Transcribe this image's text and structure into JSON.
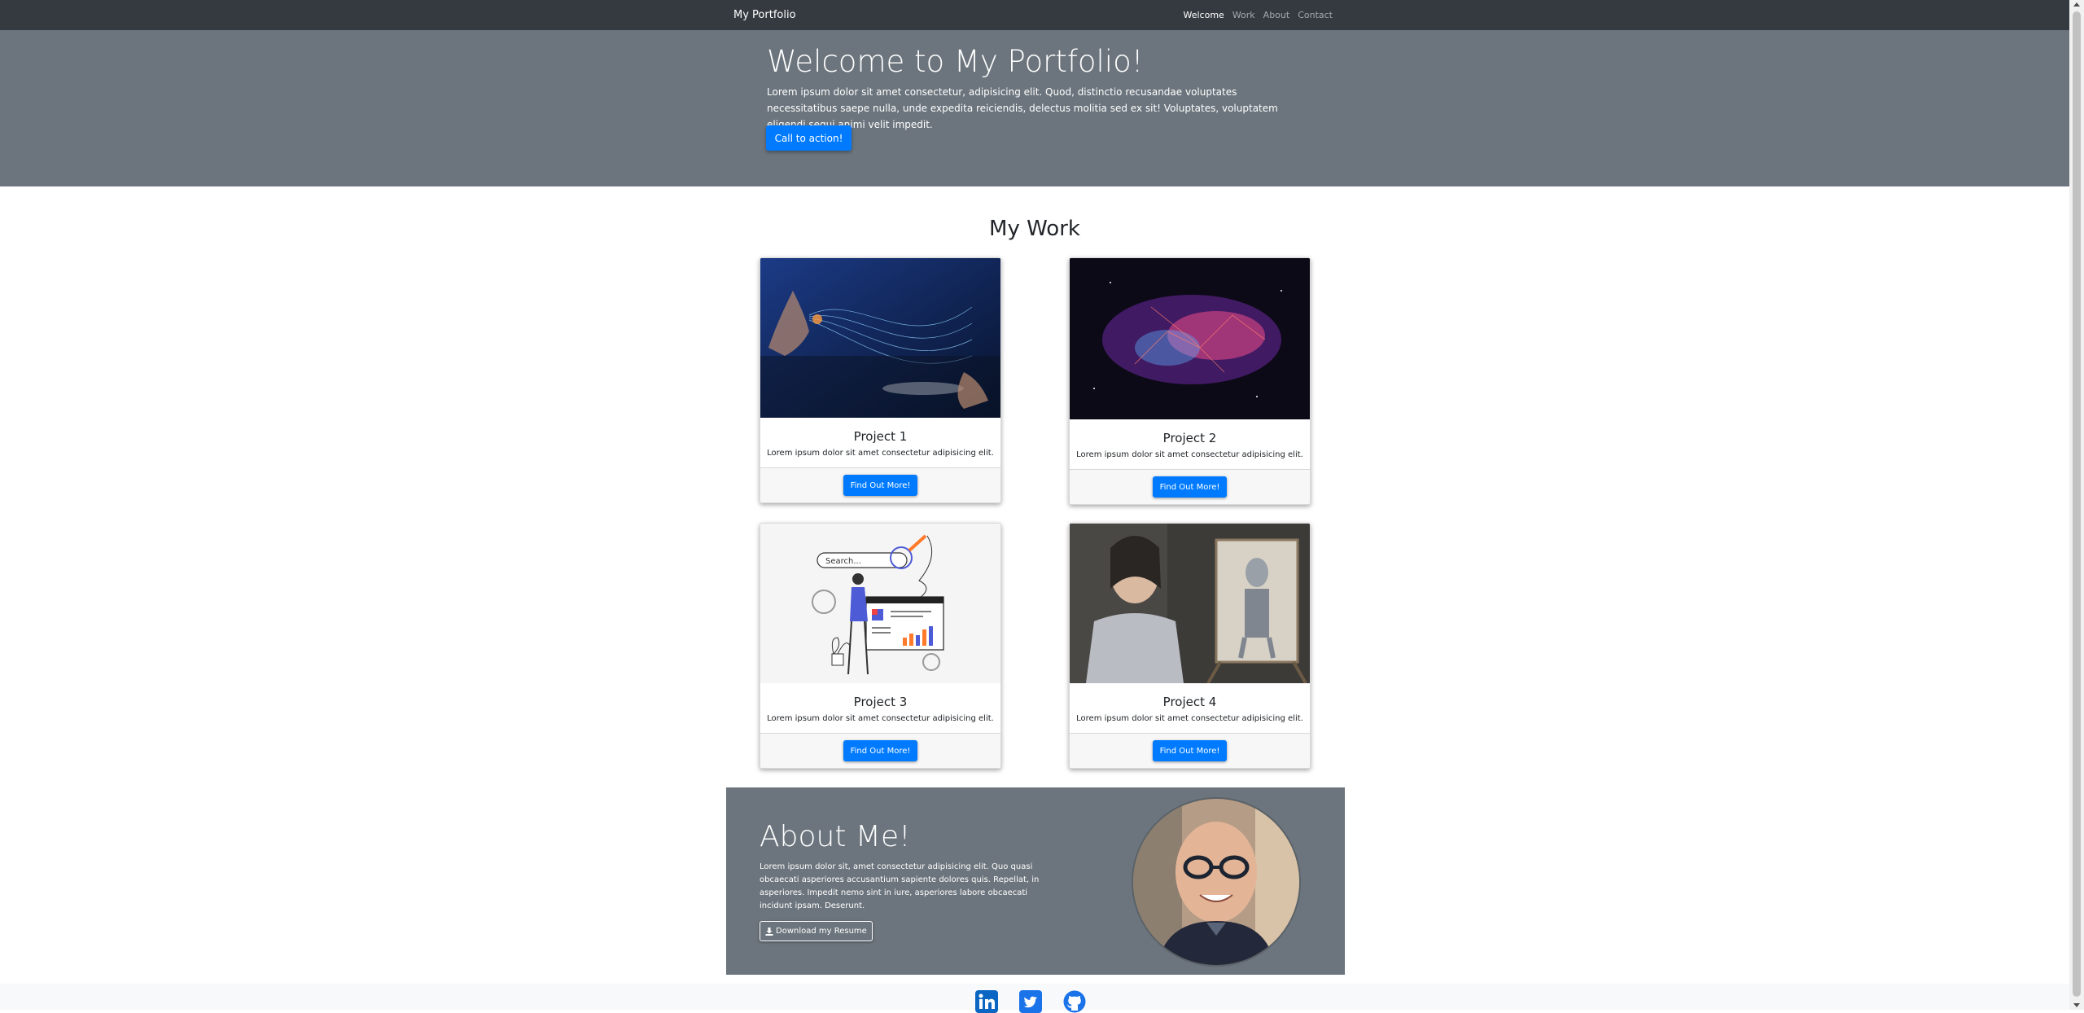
{
  "nav": {
    "brand": "My Portfolio",
    "links": [
      {
        "label": "Welcome",
        "active": true
      },
      {
        "label": "Work",
        "active": false
      },
      {
        "label": "About",
        "active": false
      },
      {
        "label": "Contact",
        "active": false
      }
    ]
  },
  "hero": {
    "title": "Welcome to My Portfolio!",
    "text": "Lorem ipsum dolor sit amet consectetur, adipisicing elit. Quod, distinctio recusandae voluptates necessitatibus saepe nulla, unde expedita reiciendis, delectus molitia sed ex sit! Voluptates, voluptatem eligendi sequi animi velit impedit.",
    "cta_label": "Call to action!"
  },
  "work": {
    "title": "My Work",
    "projects": [
      {
        "title": "Project 1",
        "text": "Lorem ipsum dolor sit amet consectetur adipisicing elit.",
        "button": "Find Out More!"
      },
      {
        "title": "Project 2",
        "text": "Lorem ipsum dolor sit amet consectetur adipisicing elit.",
        "button": "Find Out More!"
      },
      {
        "title": "Project 3",
        "text": "Lorem ipsum dolor sit amet consectetur adipisicing elit.",
        "button": "Find Out More!"
      },
      {
        "title": "Project 4",
        "text": "Lorem ipsum dolor sit amet consectetur adipisicing elit.",
        "button": "Find Out More!"
      }
    ],
    "project3_search_text": "Search..."
  },
  "about": {
    "title": "About Me!",
    "text": "Lorem ipsum dolor sit, amet consectetur adipisicing elit. Quo quasi obcaecati asperiores accusantium sapiente dolores quis. Repellat, in asperiores. Impedit nemo sint in iure, asperiores labore obcaecati incidunt ipsam. Deserunt.",
    "resume_label": "Download my Resume"
  },
  "footer": {
    "icons": [
      "linkedin-icon",
      "twitter-icon",
      "github-icon"
    ]
  },
  "colors": {
    "navbar": "#343a40",
    "hero": "#6c757d",
    "primary": "#007bff",
    "footer": "#f8f9fa"
  }
}
